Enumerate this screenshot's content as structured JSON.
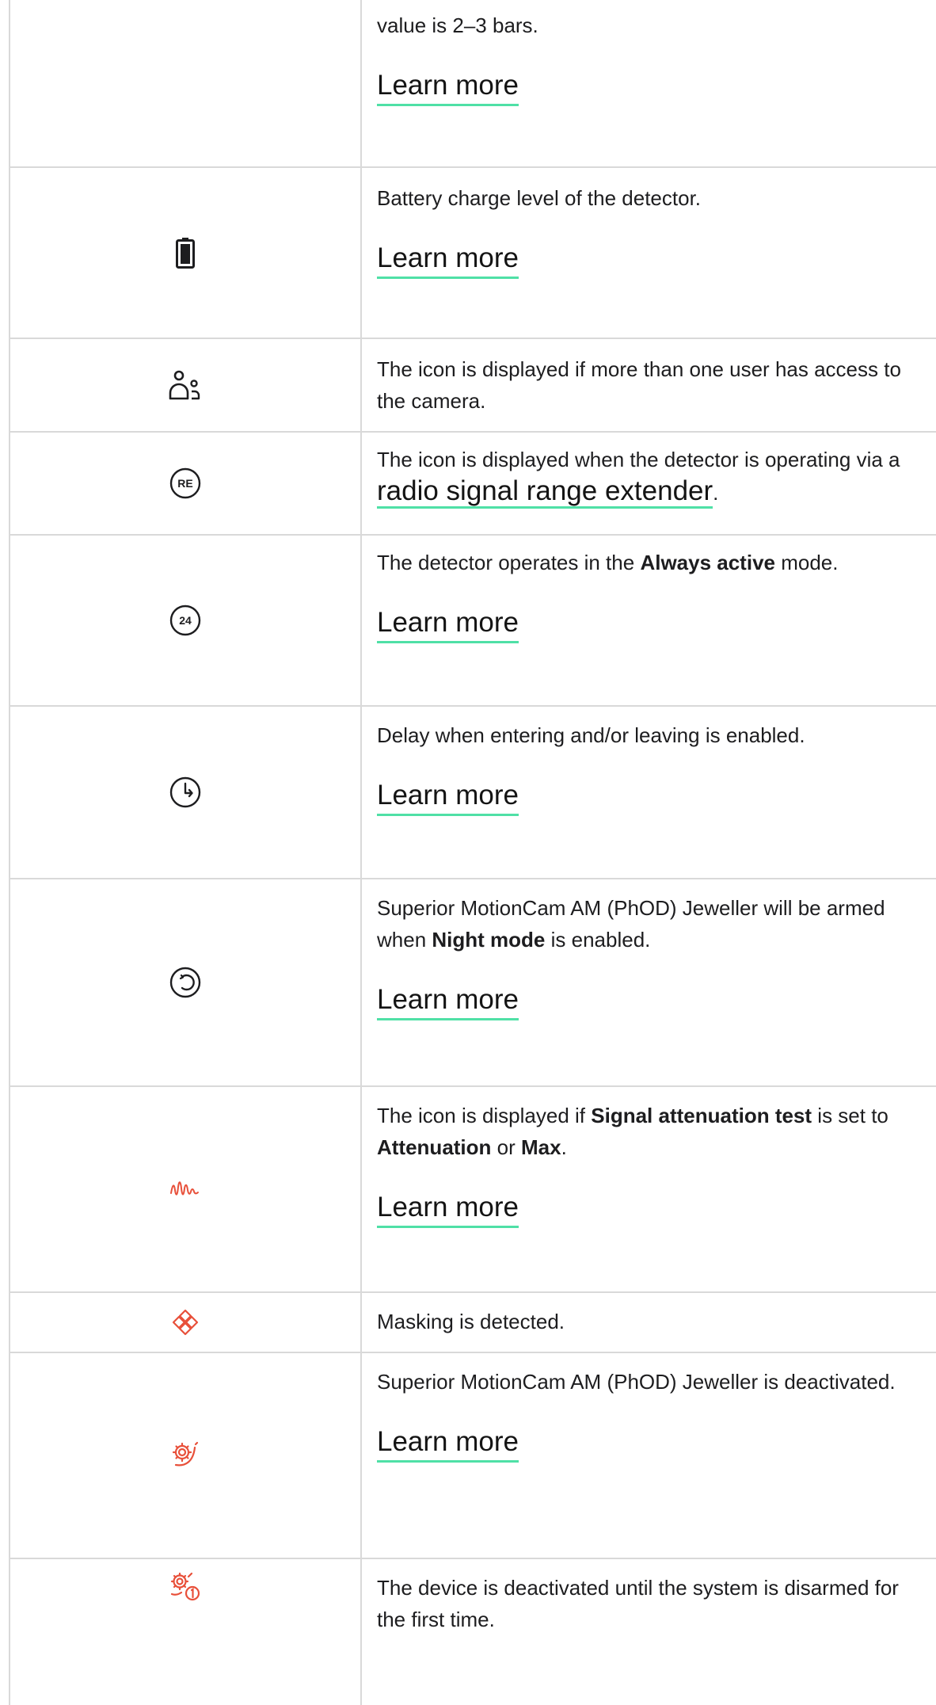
{
  "learn_more": "Learn more",
  "rows": [
    {
      "text": "value is 2–3 bars.",
      "icon": "signal-icon"
    },
    {
      "text": "Battery charge level of the detector.",
      "icon": "battery-icon"
    },
    {
      "text": "The icon is displayed if more than one user has access to the camera.",
      "icon": "users-icon"
    },
    {
      "text_before": "The icon is displayed when the detector is operating via a ",
      "link": "radio signal range extender",
      "text_after": ".",
      "icon": "range-extender-icon",
      "icon_label": "RE"
    },
    {
      "text_before": "The detector operates in the ",
      "bold": "Always active",
      "text_after": " mode.",
      "icon": "always-active-icon",
      "icon_label": "24"
    },
    {
      "text": "Delay when entering and/or leaving is enabled.",
      "icon": "delay-clock-icon"
    },
    {
      "text_before": "Superior MotionCam AM (PhOD) Jeweller will be armed when ",
      "bold": "Night mode",
      "text_after": " is enabled.",
      "icon": "night-mode-icon"
    },
    {
      "text_1": "The icon is displayed if ",
      "bold_1": "Signal attenuation test",
      "text_2": " is set to ",
      "bold_2": "Attenuation",
      "text_3": " or ",
      "bold_3": "Max",
      "text_4": ".",
      "icon": "signal-attenuation-icon"
    },
    {
      "text": "Masking is detected.",
      "icon": "masking-icon"
    },
    {
      "text": "Superior MotionCam AM (PhOD) Jeweller is deactivated.",
      "icon": "deactivated-icon"
    },
    {
      "text": "The device is deactivated until the system is disarmed for the first time.",
      "icon": "deactivated-until-disarm-icon"
    }
  ],
  "colors": {
    "link_underline": "#4fe0a6",
    "alert": "#e8503a",
    "border": "#d9d9d9"
  }
}
